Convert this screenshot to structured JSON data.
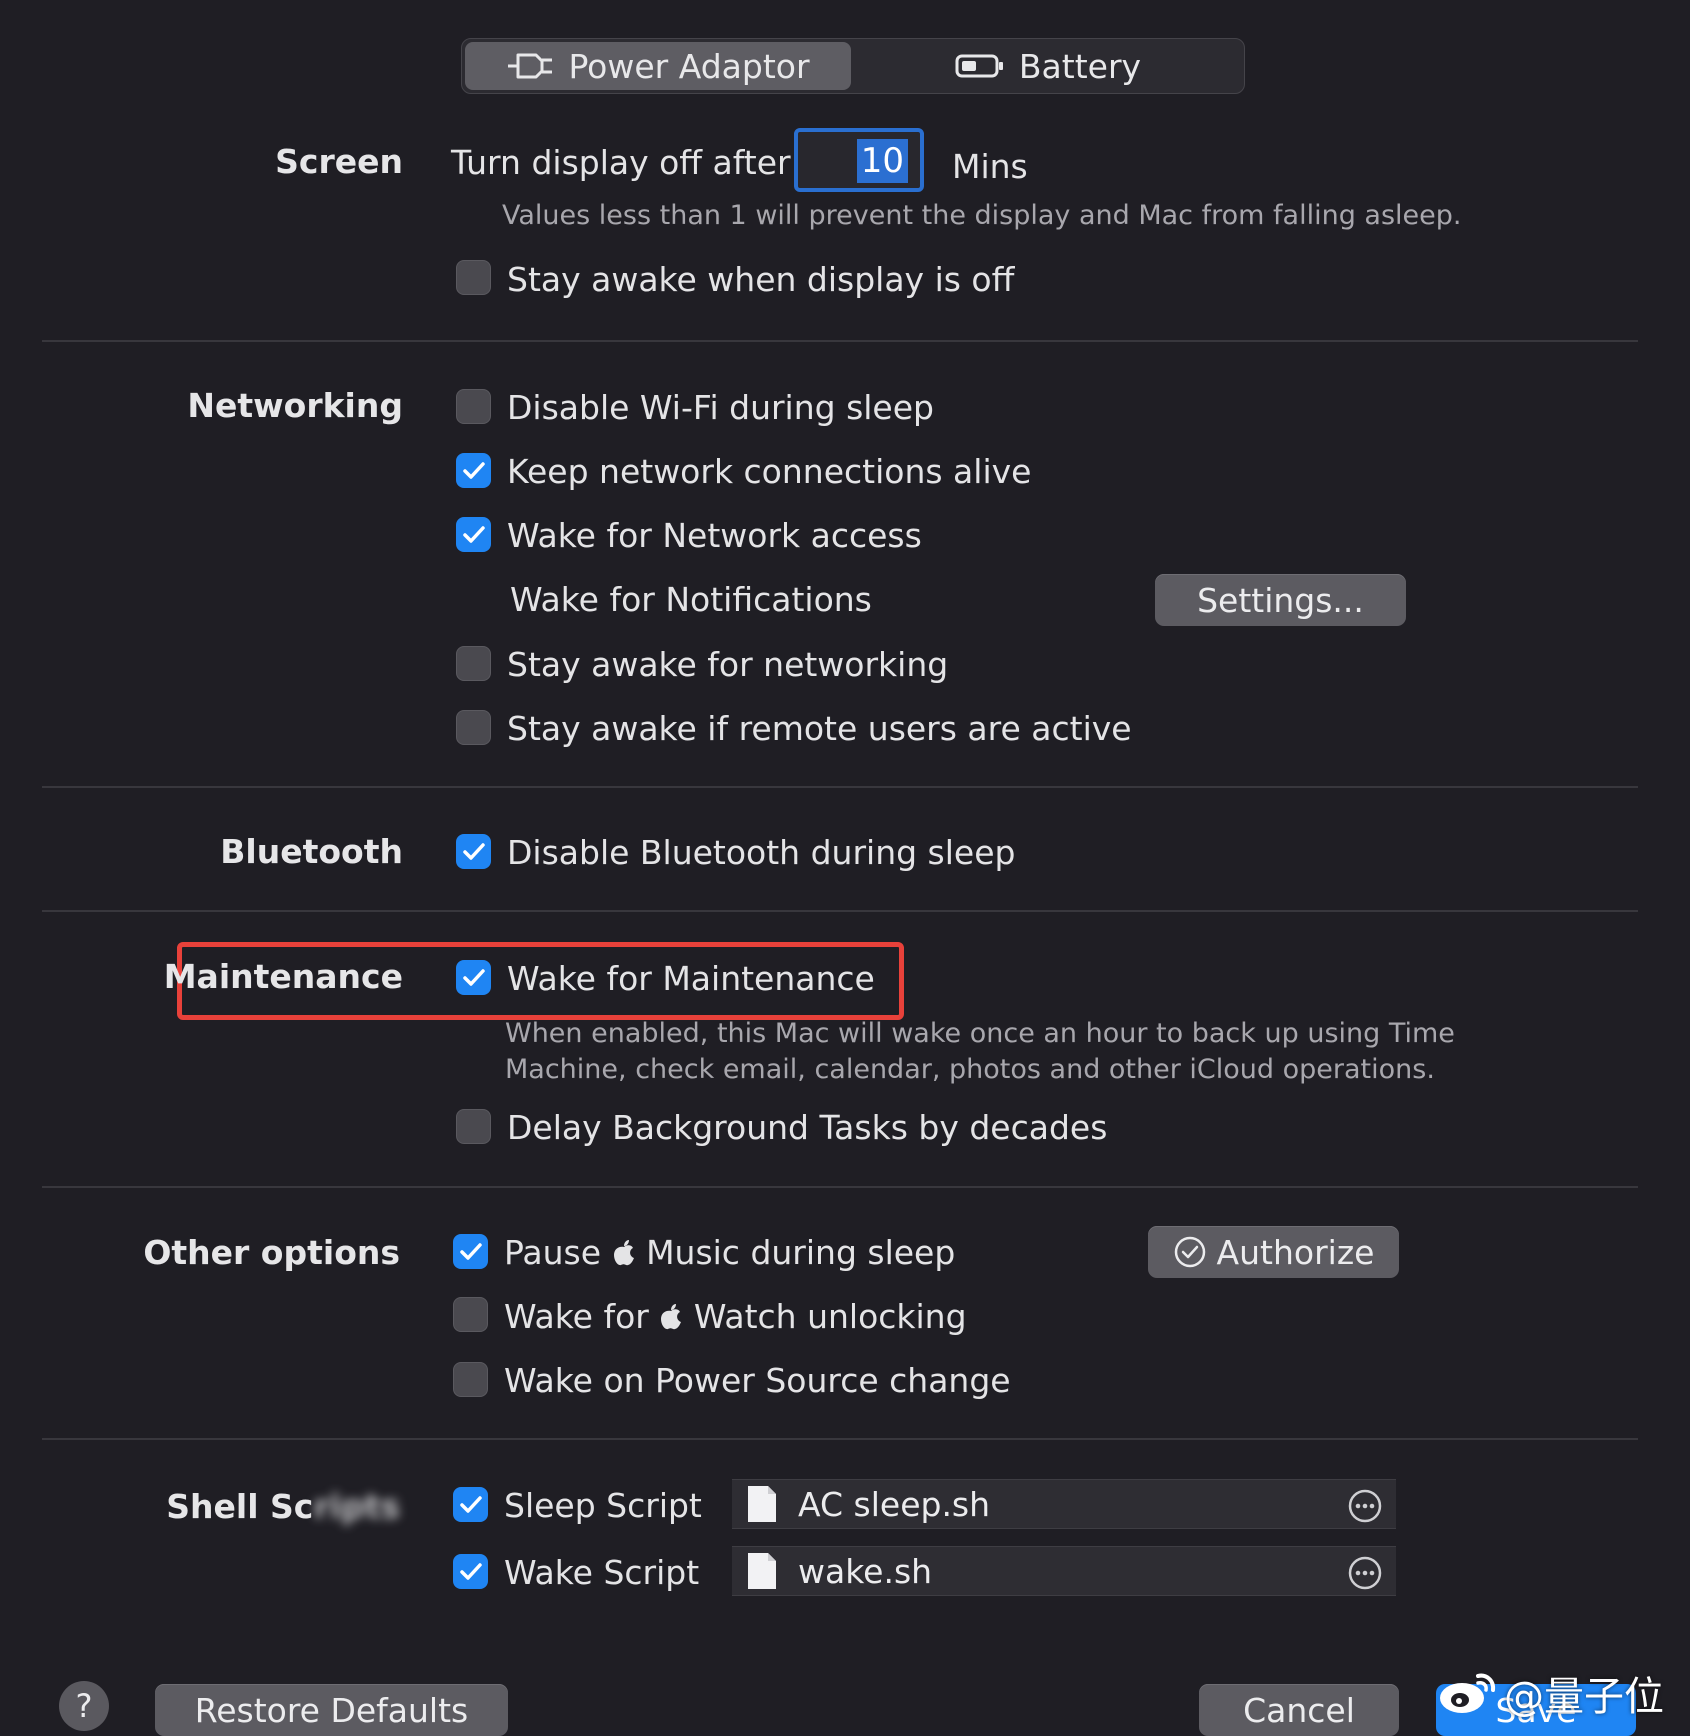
{
  "tabs": [
    {
      "label": "Power Adaptor",
      "icon": "power-plug-icon",
      "active": true
    },
    {
      "label": "Battery",
      "icon": "battery-icon",
      "active": false
    }
  ],
  "screen": {
    "label": "Screen",
    "turn_off_label": "Turn display off after",
    "minutes_value": "10",
    "unit": "Mins",
    "hint": "Values less than 1 will prevent the display and Mac from falling asleep.",
    "stay_awake": {
      "label": "Stay awake when display is off",
      "checked": false
    }
  },
  "networking": {
    "label": "Networking",
    "items": [
      {
        "label": "Disable Wi-Fi during sleep",
        "checked": false
      },
      {
        "label": "Keep network connections alive",
        "checked": true
      },
      {
        "label": "Wake for Network access",
        "checked": true
      }
    ],
    "notifications_label": "Wake for Notifications",
    "settings_button": "Settings...",
    "items2": [
      {
        "label": "Stay awake for networking",
        "checked": false
      },
      {
        "label": "Stay awake if remote users are active",
        "checked": false
      }
    ]
  },
  "bluetooth": {
    "label": "Bluetooth",
    "item": {
      "label": "Disable Bluetooth during sleep",
      "checked": true
    }
  },
  "maintenance": {
    "label": "Maintenance",
    "item": {
      "label": "Wake for Maintenance",
      "checked": true
    },
    "hint_line1": "When enabled, this Mac will wake once an hour to back up using Time",
    "hint_line2": "Machine, check email, calendar, photos and other iCloud operations.",
    "delay": {
      "label": "Delay Background Tasks by decades",
      "checked": false
    }
  },
  "other": {
    "label": "Other options",
    "pause": {
      "prefix": "Pause",
      "suffix": "Music during sleep",
      "checked": true
    },
    "watch": {
      "prefix": "Wake for",
      "suffix": "Watch unlocking",
      "checked": false
    },
    "power": {
      "label": "Wake on Power Source change",
      "checked": false
    },
    "authorize_button": "Authorize",
    "apple_glyph": ""
  },
  "shell": {
    "label": "Shell Sc",
    "sleep": {
      "label": "Sleep Script",
      "checked": true,
      "file": "AC sleep.sh"
    },
    "wake": {
      "label": "Wake Script",
      "checked": true,
      "file": "wake.sh"
    }
  },
  "footer": {
    "help": "?",
    "restore": "Restore Defaults",
    "cancel": "Cancel",
    "save": "Save",
    "watermark": "@量子位"
  },
  "colors": {
    "accent": "#1f85f3",
    "highlight": "#e8413a",
    "background": "#1f1e24"
  }
}
